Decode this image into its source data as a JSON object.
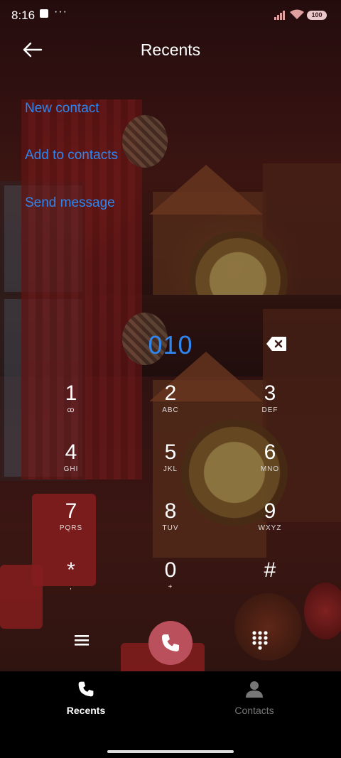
{
  "status_bar": {
    "time": "8:16",
    "more": "···",
    "battery": "100"
  },
  "header": {
    "title": "Recents",
    "back_icon": "back-arrow-icon"
  },
  "actions": [
    {
      "label": "New contact"
    },
    {
      "label": "Add to contacts"
    },
    {
      "label": "Send message"
    }
  ],
  "dialer": {
    "number": "010",
    "keys": [
      {
        "digit": "1",
        "letters": "ꝏ"
      },
      {
        "digit": "2",
        "letters": "ABC"
      },
      {
        "digit": "3",
        "letters": "DEF"
      },
      {
        "digit": "4",
        "letters": "GHI"
      },
      {
        "digit": "5",
        "letters": "JKL"
      },
      {
        "digit": "6",
        "letters": "MNO"
      },
      {
        "digit": "7",
        "letters": "PQRS"
      },
      {
        "digit": "8",
        "letters": "TUV"
      },
      {
        "digit": "9",
        "letters": "WXYZ"
      },
      {
        "digit": "*",
        "letters": ","
      },
      {
        "digit": "0",
        "letters": "+"
      },
      {
        "digit": "#",
        "letters": ""
      }
    ]
  },
  "bottom_nav": [
    {
      "label": "Recents",
      "icon": "phone-icon",
      "active": true
    },
    {
      "label": "Contacts",
      "icon": "person-icon",
      "active": false
    }
  ],
  "colors": {
    "accent": "#2f86ef",
    "call_button": "#b9505c"
  }
}
